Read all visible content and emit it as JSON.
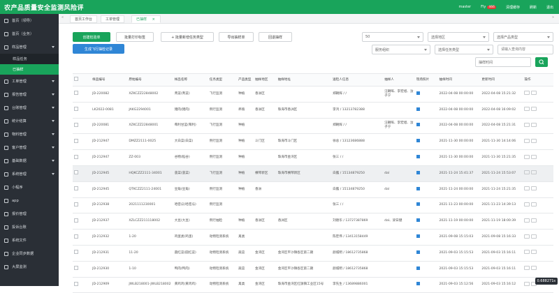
{
  "app": {
    "title": "农产品质量安全监测风险评"
  },
  "topbar": {
    "user": "master",
    "notice": "Fly",
    "notice_count": "466",
    "lock": "清理缓存",
    "refresh": "刷新",
    "logout": "退出"
  },
  "sidebar": {
    "items": [
      {
        "label": "首页（领导）"
      },
      {
        "label": "首页（业务）"
      },
      {
        "label": "样品管理",
        "expanded": true
      },
      {
        "sub": true,
        "label": "样品任务"
      },
      {
        "sub": true,
        "label": "已抽样",
        "active": true
      },
      {
        "label": "工单管理"
      },
      {
        "label": "报告管理"
      },
      {
        "label": "台账管理"
      },
      {
        "label": "统计结算"
      },
      {
        "label": "物料管理"
      },
      {
        "label": "客户管理"
      },
      {
        "label": "基础数据"
      },
      {
        "label": "系统管理"
      },
      {
        "label": "小程序"
      },
      {
        "label": "app"
      },
      {
        "label": "报价管理"
      },
      {
        "label": "投诉台账"
      },
      {
        "label": "系统文件"
      },
      {
        "label": "企业同步数据"
      },
      {
        "label": "大屏监测"
      }
    ]
  },
  "tabs": [
    "首页工作台",
    "工单管理",
    "已抽样"
  ],
  "toolbar": {
    "create": "创建检验单",
    "batch_print": "批量打印标签",
    "batch_task": "+ 批量新增任务类型",
    "export": "导出抽样单",
    "resample": "回退抽样",
    "scan": "生成飞行抽检记录"
  },
  "filters": {
    "page_size": "50",
    "sampling_area": "选择地区",
    "product_type": "选择产品类型",
    "org": "服务组织",
    "task_type": "选择任务类型",
    "search_placeholder": "请输入查询内容",
    "sample_time": "抽样时间"
  },
  "table": {
    "headers": [
      "样品编号",
      "原始编号",
      "样品名称",
      "任务类型",
      "产品类型",
      "抽样地区",
      "抽样地址",
      "送检人信息",
      "抽样人",
      "现场照片",
      "抽样时间",
      "更新时间",
      "操作"
    ],
    "rows": [
      [
        "JD-220082",
        "XZKCZZ22848002",
        "青菜(青菜)",
        "飞行监测",
        "种植",
        "香洲区",
        "",
        "郑朝辉 / /",
        "汪朝晖、李宏旭、汝子宁",
        "■",
        "2022-04-08 00:00:00",
        "2022-04-08 15:21:32"
      ],
      [
        "LK2022-0081",
        "JAKG2294001",
        "猪肉(猪肉)",
        "例行监测",
        "养殖",
        "香洲区",
        "珠海市香洲区",
        "李鸿 / 13213782388",
        "",
        "■",
        "2022-04-08 00:00:00",
        "2022-04-08 16:09:02"
      ],
      [
        "JD-220081",
        "XZKCZZ22848001",
        "莓利甘蓝(莓利)",
        "飞行监测",
        "种植",
        "",
        "",
        "郑朝辉 / /",
        "汪朝晖、李宏旭、汝子宁",
        "■",
        "2022-04-08 00:00:00",
        "2022-04-08 15:21:31"
      ],
      [
        "JD-212947",
        "DMZZ2111-0025",
        "大白菜(白菜)",
        "例行监测",
        "种植",
        "斗门区",
        "珠海市斗门区",
        "徐总 / 13123686888",
        "",
        "■",
        "2021-11-30 00:00:00",
        "2021-11-30 14:14:06"
      ],
      [
        "JD-212947",
        "ZZ-003",
        "谷物(稻谷)",
        "例行监测",
        "种植",
        "",
        "珠海市金湾区",
        "张三 / /",
        "",
        "■",
        "2021-11-30 00:00:00",
        "2021-11-30 15:21:35"
      ],
      [
        "JD-212945",
        "HQKCZZ2111-34001",
        "菠菜(菠菜)",
        "飞行监测",
        "种植",
        "横琴新区",
        "珠海市横琴新区",
        "白露 / 15134879250",
        "dal",
        "■",
        "2021-11-24 15:41:37",
        "2021-11-24 15:53:07"
      ],
      [
        "JD-212945",
        "QTKCZZ2111-24001",
        "豆角(豆角)",
        "例行监测",
        "种植",
        "香洲",
        "",
        "白露 / 15134879250",
        "dal",
        "■",
        "2021-11-24 00:00:00",
        "2021-11-24 15:21:35"
      ],
      [
        "JD-212938",
        "2021111230001",
        "哈密瓜(哈密瓜)",
        "例行监测",
        "",
        "",
        "",
        "张三 / /",
        "",
        "■",
        "2021-11-23 00:00:00",
        "2021-11-23 14:39:13"
      ],
      [
        "JD-212937",
        "XZLCZZ211118002",
        "大豆(大豆)",
        "例行抽检",
        "种植",
        "香洲区",
        "香洲区",
        "刘德华 / 13727387869",
        "dal、梁日健",
        "■",
        "2021-11-19 00:00:00",
        "2021-11-19 18:00:39"
      ],
      [
        "JD-212932",
        "1-20",
        "鸡蛋类(鸡蛋)",
        "动物检测系统",
        "禽类",
        "",
        "",
        "陈宏伟 / 13413158449",
        "",
        "■",
        "2021-09-08 15:15:03",
        "2021-09-08 15:16:33"
      ],
      [
        "JD-212931",
        "11-20",
        "圆红菜(圆红菜)",
        "动物检测系统",
        "蔬菜",
        "金湾区",
        "金湾区平沙镇各区第二期",
        "颜城明 / 18612735868",
        "",
        "■",
        "2021-09-03 15:15:53",
        "2021-09-03 15:16:11"
      ],
      [
        "JD-212930",
        "1-10",
        "鸭肉(鸭肉)",
        "动物检测系统",
        "蔬菜",
        "金湾区",
        "金湾区平沙镇各区第二期",
        "颜城明 / 18612735868",
        "",
        "■",
        "2021-09-03 15:15:53",
        "2021-09-03 15:16:11"
      ],
      [
        "JD-212909",
        "JWLB218001-JWLB218002",
        "黄鸡鸡(黄鸡鸡)",
        "动物检测系统",
        "禽类",
        "金湾区",
        "珠海市金湾区红旗镇工业区15号",
        "李先生 / 13689886001",
        "",
        "■",
        "2021-09-03 15:12:56",
        "2021-09-03 15:16:12"
      ]
    ]
  },
  "fps": "0.688271s"
}
